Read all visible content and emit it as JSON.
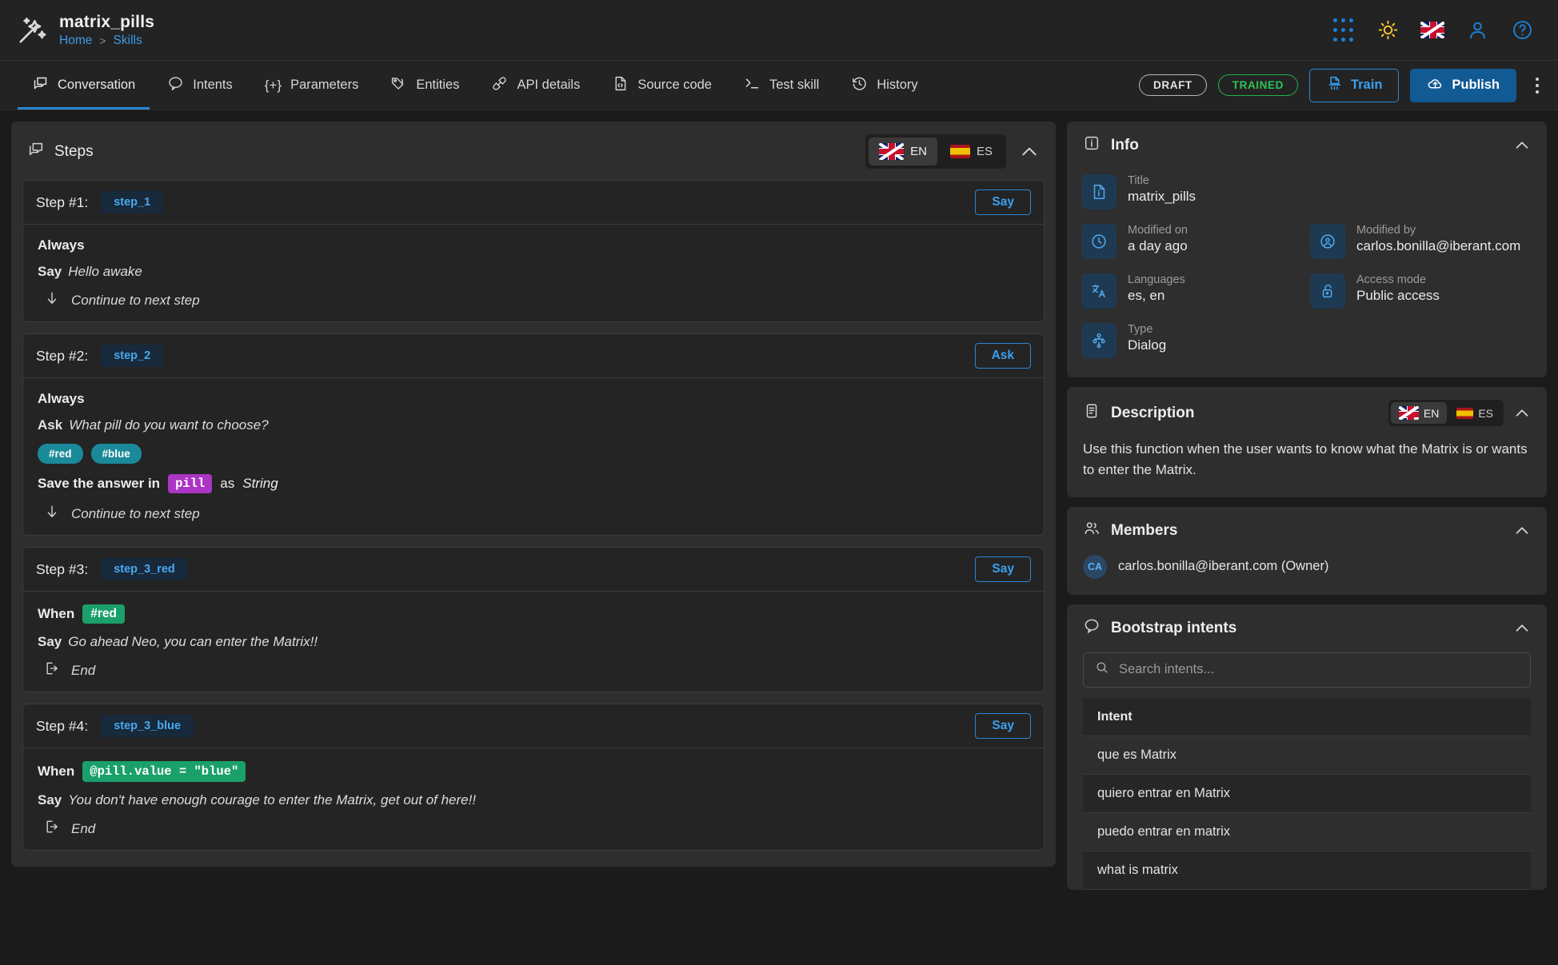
{
  "topbar": {
    "app_title": "matrix_pills",
    "breadcrumbs": [
      "Home",
      "Skills"
    ],
    "breadcrumb_separator": ">",
    "icons": [
      "apps-grid-icon",
      "brightness-sun-icon",
      "flag-uk-icon",
      "user-account-icon",
      "help-circle-icon"
    ]
  },
  "tabs": [
    {
      "label": "Conversation",
      "icon": "conversation-icon",
      "active": true
    },
    {
      "label": "Intents",
      "icon": "chat-bubble-icon",
      "active": false
    },
    {
      "label": "Parameters",
      "icon": "braces-plus-icon",
      "active": false
    },
    {
      "label": "Entities",
      "icon": "tag-icon",
      "active": false
    },
    {
      "label": "API details",
      "icon": "plug-icon",
      "active": false
    },
    {
      "label": "Source code",
      "icon": "file-code-icon",
      "active": false
    },
    {
      "label": "Test skill",
      "icon": "terminal-icon",
      "active": false
    },
    {
      "label": "History",
      "icon": "clock-history-icon",
      "active": false
    }
  ],
  "actions": {
    "draft_badge": "DRAFT",
    "trained_badge": "TRAINED",
    "train_label": "Train",
    "publish_label": "Publish",
    "more_label": "⋮"
  },
  "steps_panel": {
    "title": "Steps",
    "languages": [
      {
        "code": "EN",
        "flag": "uk",
        "selected": true
      },
      {
        "code": "ES",
        "flag": "es",
        "selected": false
      }
    ],
    "steps": [
      {
        "label": "Step #1:",
        "name": "step_1",
        "action_button": "Say",
        "condition": "Always",
        "action_verb": "Say",
        "action_text": "Hello awake",
        "flow": "Continue to next step",
        "flow_icon": "arrow-down-icon"
      },
      {
        "label": "Step #2:",
        "name": "step_2",
        "action_button": "Ask",
        "condition": "Always",
        "action_verb": "Ask",
        "action_text": "What pill do you want to choose?",
        "options": [
          "#red",
          "#blue"
        ],
        "save_prefix": "Save the answer in",
        "save_variable": "pill",
        "save_middle": "as",
        "save_type": "String",
        "flow": "Continue to next step",
        "flow_icon": "arrow-down-icon"
      },
      {
        "label": "Step #3:",
        "name": "step_3_red",
        "action_button": "Say",
        "condition_verb": "When",
        "condition_chip": "#red",
        "action_verb": "Say",
        "action_text": "Go ahead Neo, you can enter the Matrix!!",
        "flow": "End",
        "flow_icon": "exit-door-icon"
      },
      {
        "label": "Step #4:",
        "name": "step_3_blue",
        "action_button": "Say",
        "condition_verb": "When",
        "condition_code": "@pill.value = \"blue\"",
        "action_verb": "Say",
        "action_text": "You don't have enough courage to enter the Matrix, get out of here!!",
        "flow": "End",
        "flow_icon": "exit-door-icon"
      }
    ]
  },
  "info": {
    "title": "Info",
    "fields": [
      {
        "key": "Title",
        "value": "matrix_pills",
        "icon": "document-info-icon",
        "full": true
      },
      {
        "key": "Modified on",
        "value": "a day ago",
        "icon": "clock-icon",
        "full": false
      },
      {
        "key": "Modified by",
        "value": "carlos.bonilla@iberant.com",
        "icon": "user-circle-icon",
        "full": false
      },
      {
        "key": "Languages",
        "value": "es, en",
        "icon": "translate-icon",
        "full": false
      },
      {
        "key": "Access mode",
        "value": "Public access",
        "icon": "unlock-icon",
        "full": false
      },
      {
        "key": "Type",
        "value": "Dialog",
        "icon": "hierarchy-icon",
        "full": false
      }
    ]
  },
  "description": {
    "title": "Description",
    "languages": [
      {
        "code": "EN",
        "flag": "uk",
        "selected": true
      },
      {
        "code": "ES",
        "flag": "es",
        "selected": false
      }
    ],
    "text": "Use this function when the user wants to know what the Matrix is or wants to enter the Matrix."
  },
  "members": {
    "title": "Members",
    "list": [
      {
        "initials": "CA",
        "name": "carlos.bonilla@iberant.com (Owner)"
      }
    ]
  },
  "bootstrap_intents": {
    "title": "Bootstrap intents",
    "search_placeholder": "Search intents...",
    "search_value": "",
    "column_header": "Intent",
    "rows": [
      "que es Matrix",
      "quiero entrar en Matrix",
      "puedo entrar en matrix",
      "what is matrix"
    ]
  },
  "colors": {
    "page_bg": "#1b1b1b",
    "panel_bg": "#2e2e2e",
    "card_bg": "#242424",
    "accent_blue": "#2b86d6",
    "accent_green": "#2fc257",
    "chip_teal": "#1a8a9a",
    "chip_purple": "#ab35c4",
    "chip_green": "#1aa06a"
  }
}
